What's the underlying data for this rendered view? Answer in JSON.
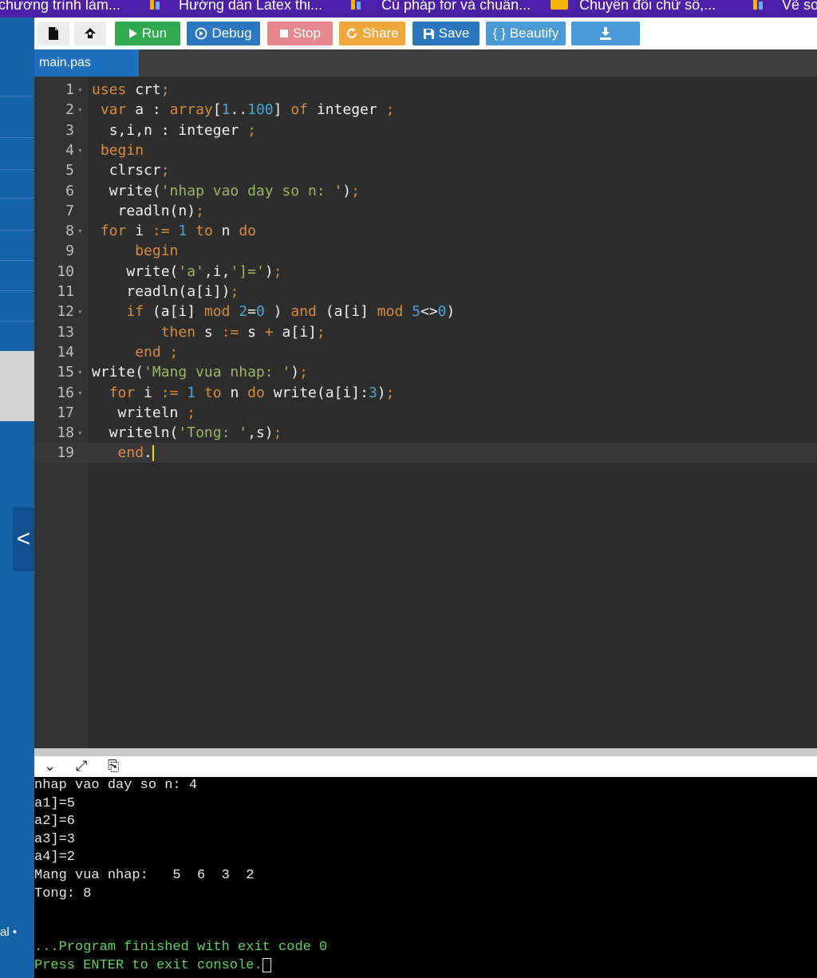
{
  "bookmarks": [
    {
      "label": "chương trình làm...",
      "icon": "bar-chart-icon"
    },
    {
      "label": "Hướng dẫn Latex thi...",
      "icon": "bar-chart-icon"
    },
    {
      "label": "Cú pháp for và chuẩn...",
      "icon": "bar-chart-icon"
    },
    {
      "label": "Chuyển đổi chữ số,...",
      "icon": "folder-icon"
    },
    {
      "label": "Vẽ sơ",
      "icon": "bar-chart-icon"
    }
  ],
  "sidebar": {
    "bottom_text": "al •",
    "collapse_glyph": "<"
  },
  "toolbar": {
    "new_file_icon": "file-icon",
    "upload_icon": "upload-icon",
    "run_label": "Run",
    "debug_label": "Debug",
    "stop_label": "Stop",
    "share_label": "Share",
    "save_label": "Save",
    "beautify_label": "Beautify",
    "download_icon": "download-icon"
  },
  "tab": {
    "name": "main.pas"
  },
  "editor": {
    "language": "Pascal",
    "lines": [
      "uses crt;",
      " var a : array[1..100] of integer ;",
      "  s,i,n : integer ;",
      " begin",
      "  clrscr;",
      "  write('nhap vao day so n: ');",
      "   readln(n);",
      " for i := 1 to n do",
      "     begin",
      "    write('a',i,']=');",
      "    readln(a[i]);",
      "    if (a[i] mod 2=0 ) and (a[i] mod 5<>0)",
      "        then s := s + a[i];",
      "     end ;",
      "write('Mang vua nhap: ');",
      "  for i := 1 to n do write(a[i]:3);",
      "   writeln ;",
      "  writeln('Tong: ',s);",
      "   end."
    ],
    "line_numbers": [
      "1",
      "2",
      "3",
      "4",
      "5",
      "6",
      "7",
      "8",
      "9",
      "10",
      "11",
      "12",
      "13",
      "14",
      "15",
      "16",
      "17",
      "18",
      "19"
    ],
    "foldable_lines": [
      1,
      2,
      4,
      8,
      12,
      15,
      16,
      18
    ],
    "active_line": 19
  },
  "console": {
    "output": [
      "nhap vao day so n: 4",
      "a1]=5",
      "a2]=6",
      "a3]=3",
      "a4]=2",
      "Mang vua nhap:   5  6  3  2",
      "Tong: 8"
    ],
    "status": "...Program finished with exit code 0",
    "prompt": "Press ENTER to exit console."
  },
  "colors": {
    "keyword": "#d98b3a",
    "number": "#4da3d6",
    "string": "#9ab75e",
    "run": "#2fa84f",
    "debug": "#2b77c0",
    "stop": "#e5878b",
    "share": "#f0a83c",
    "console_status": "#5fd45f",
    "sidebar": "#1462a8",
    "bookmarks_bar": "#4b1fa8"
  }
}
